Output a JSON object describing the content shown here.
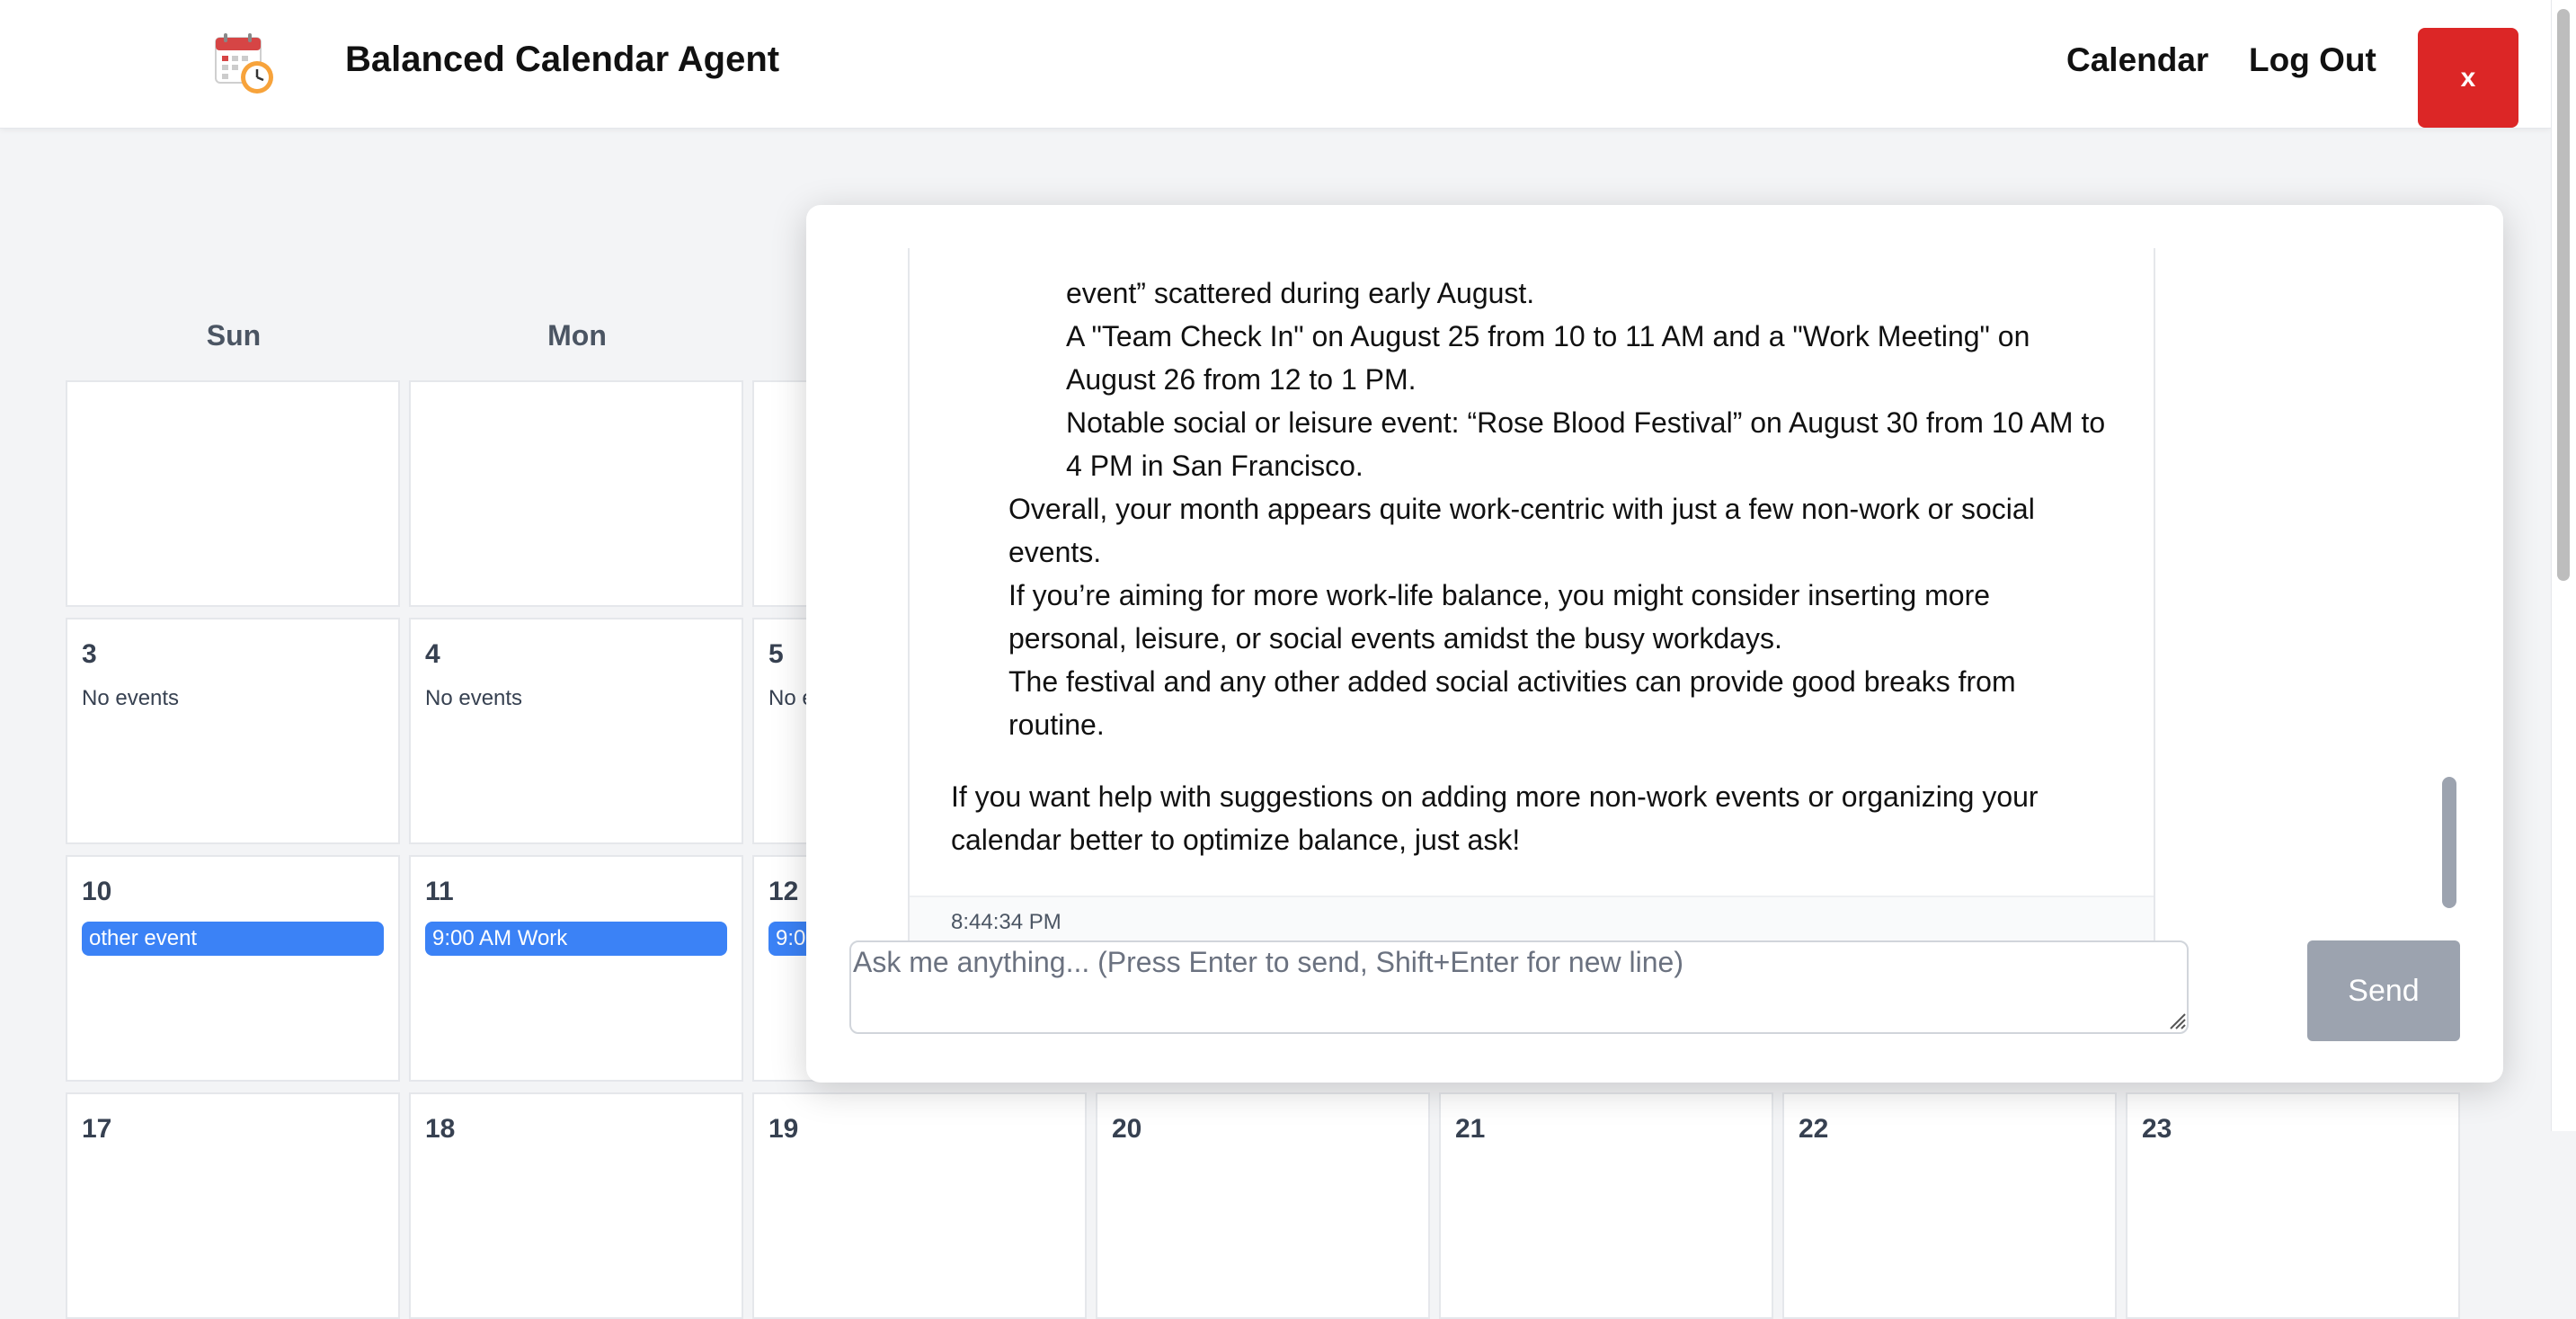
{
  "header": {
    "app_title": "Balanced Calendar Agent",
    "nav": {
      "calendar": "Calendar",
      "logout": "Log Out"
    },
    "close_label": "x"
  },
  "calendar": {
    "weekdays": [
      "Sun",
      "Mon"
    ],
    "cells": [
      {
        "day": "",
        "status": ""
      },
      {
        "day": "",
        "status": ""
      },
      {
        "day": "",
        "status": ""
      },
      {
        "day": "3",
        "status": "No events"
      },
      {
        "day": "4",
        "status": "No events"
      },
      {
        "day": "5",
        "status": "No e"
      },
      {
        "day": "10",
        "event": "other event"
      },
      {
        "day": "11",
        "event": "9:00 AM Work"
      },
      {
        "day": "12",
        "event": "9:0"
      },
      {
        "day": "17"
      },
      {
        "day": "18"
      },
      {
        "day": "19"
      },
      {
        "day": "20"
      },
      {
        "day": "21"
      },
      {
        "day": "22"
      },
      {
        "day": "23"
      }
    ]
  },
  "chat": {
    "lines": [
      "event” scattered during early August.",
      "A \"Team Check In\" on August 25 from 10 to 11 AM and a \"Work Meeting\" on",
      "August 26 from 12 to 1 PM.",
      "Notable social or leisure event: “Rose Blood Festival” on August 30 from 10 AM to",
      "4 PM in San Francisco.",
      "Overall, your month appears quite work-centric with just a few non-work or social",
      "events.",
      "If you’re aiming for more work-life balance, you might consider inserting more",
      "personal, leisure, or social events amidst the busy workdays.",
      "The festival and any other added social activities can provide good breaks from",
      "routine.",
      "If you want help with suggestions on adding more non-work events or organizing your",
      "calendar better to optimize balance, just ask!"
    ],
    "timestamp": "8:44:34 PM",
    "input_placeholder": "Ask me anything... (Press Enter to send, Shift+Enter for new line)",
    "input_value": "",
    "send_label": "Send"
  },
  "colors": {
    "close_button": "#dc2626",
    "event_pill": "#3b82f6",
    "send_button": "#9ca3af"
  },
  "icons": {
    "logo": "calendar-clock-icon"
  }
}
